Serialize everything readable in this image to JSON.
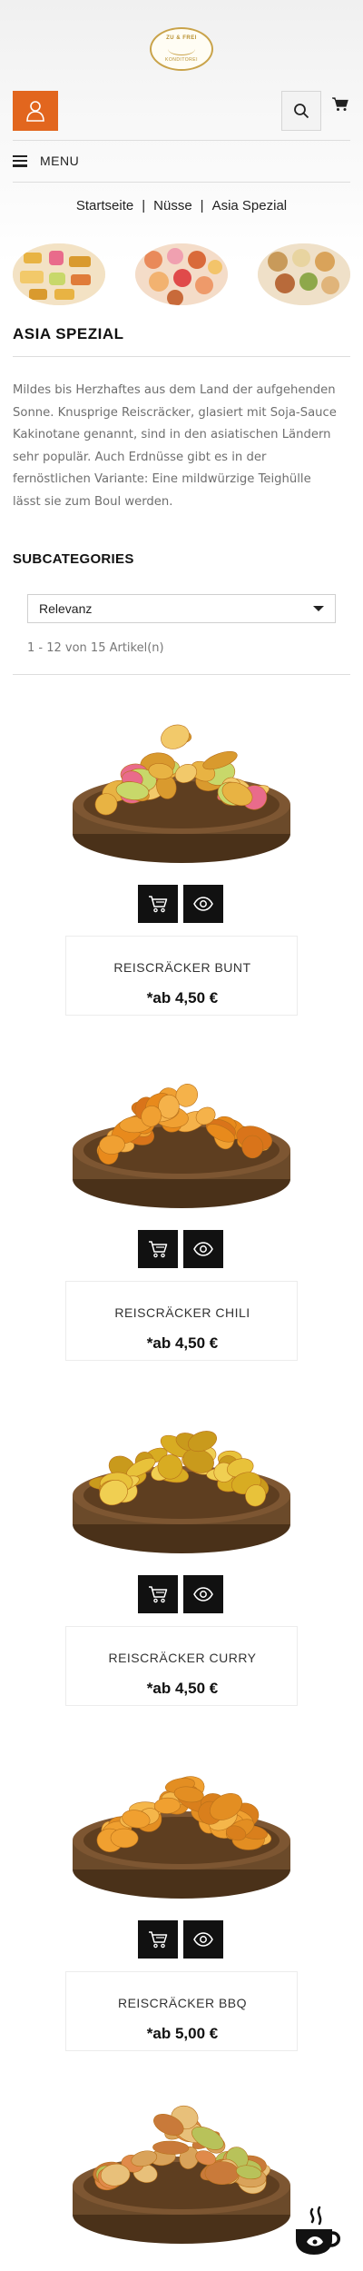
{
  "header": {
    "logo": {
      "line1": "ZU & FREI",
      "line2": "KONDITOREI"
    },
    "menu_label": "MENU"
  },
  "breadcrumb": [
    "Startseite",
    "Nüsse",
    "Asia Spezial"
  ],
  "category": {
    "title": "ASIA SPEZIAL",
    "description_lines": [
      "Mildes bis Herzhaftes aus dem Land der aufgehenden",
      "Sonne. Knusprige Reiscräcker, glasiert mit Soja-Sauce",
      "Kakinotane genannt, sind in den asiatischen Ländern",
      "sehr populär. Auch Erdnüsse gibt es in der",
      "fernöstlichen Variante: Eine mildwürzige Teighülle",
      "lässt sie zum Boul werden."
    ]
  },
  "subcategories_title": "SUBCATEGORIES",
  "sort": {
    "selected": "Relevanz"
  },
  "result_count": "1 - 12 von 15 Artikel(n)",
  "products": [
    {
      "name": "REISCRÄCKER BUNT",
      "price": "*ab 4,50 €",
      "snack_colors": [
        "#e8b343",
        "#d99a2e",
        "#f2c96a",
        "#c8d86a",
        "#e96b8b"
      ]
    },
    {
      "name": "REISCRÄCKER CHILI",
      "price": "*ab 4,50 €",
      "snack_colors": [
        "#e88a1c",
        "#f0a032",
        "#d9741a",
        "#f5b24a"
      ]
    },
    {
      "name": "REISCRÄCKER CURRY",
      "price": "*ab 4,50 €",
      "snack_colors": [
        "#e8c23a",
        "#d8ac22",
        "#f0cf52",
        "#c99a1c"
      ]
    },
    {
      "name": "REISCRÄCKER BBQ",
      "price": "*ab 5,00 €",
      "snack_colors": [
        "#f0a030",
        "#e38e22",
        "#f5b64a",
        "#d97f1c"
      ]
    },
    {
      "snack_colors": [
        "#d9a35a",
        "#e8c07a",
        "#c97a3a",
        "#b8c25a",
        "#e08a4a"
      ]
    }
  ],
  "colors": {
    "accent": "#e2661e",
    "dark_button": "#111111",
    "wood": "#6b4a2a"
  },
  "icons": {
    "account": "user-icon",
    "search": "search-icon",
    "cart": "cart-icon",
    "menu": "hamburger-icon",
    "add_to_cart": "cart-icon",
    "quick_view": "eye-icon",
    "chat": "coffee-cup-icon"
  }
}
